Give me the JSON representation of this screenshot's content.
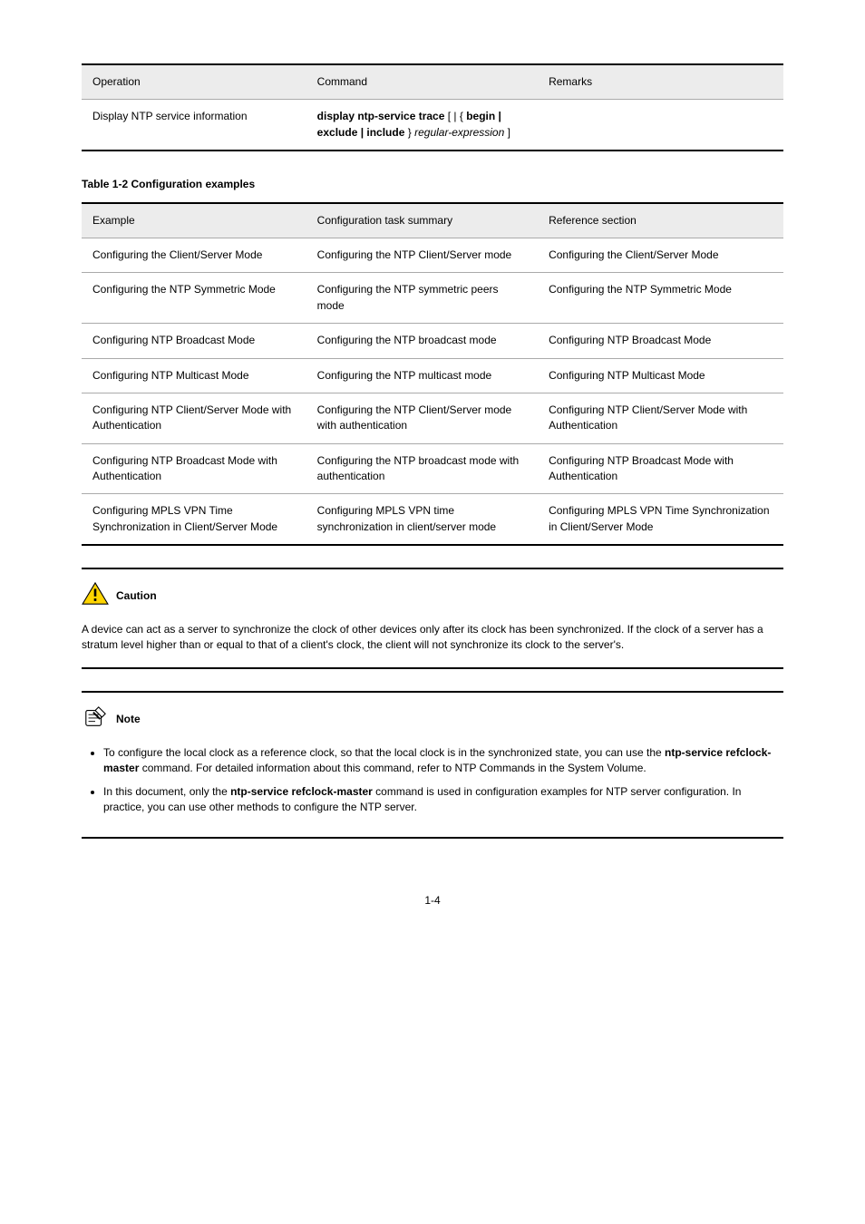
{
  "table1": {
    "headers": [
      "Operation",
      "Command",
      "Remarks"
    ],
    "rows": [
      {
        "op": "Display NTP service information",
        "cmd_prefix": "display ntp-service trace",
        "cmd_slot": " [ | { ",
        "cmd_opts": "begin | exclude | include",
        "cmd_suffix_a": " } ",
        "cmd_suffix_b": "regular-expression",
        "cmd_suffix_c": " ]",
        "remarks": ""
      }
    ]
  },
  "table2_caption": "Table 1-2 Configuration examples",
  "table2": {
    "headers": [
      "Example",
      "Configuration task summary",
      "Reference section"
    ],
    "rows": [
      {
        "example": "Configuring the Client/Server Mode",
        "task": "Configuring the NTP Client/Server mode",
        "ref": "Configuring the Client/Server Mode"
      },
      {
        "example": "Configuring the NTP Symmetric Mode",
        "task": "Configuring the NTP symmetric peers mode",
        "ref": "Configuring the NTP Symmetric Mode"
      },
      {
        "example": "Configuring NTP Broadcast Mode",
        "task": "Configuring the NTP broadcast mode",
        "ref": "Configuring NTP Broadcast Mode"
      },
      {
        "example": "Configuring NTP Multicast Mode",
        "task": "Configuring the NTP multicast mode",
        "ref": "Configuring NTP Multicast Mode"
      },
      {
        "example": "Configuring NTP Client/Server Mode with Authentication",
        "task": "Configuring the NTP Client/Server mode with authentication",
        "ref": "Configuring NTP Client/Server Mode with Authentication"
      },
      {
        "example": "Configuring NTP Broadcast Mode with Authentication",
        "task": "Configuring the NTP broadcast mode with authentication",
        "ref": "Configuring NTP Broadcast Mode with Authentication"
      },
      {
        "example": "Configuring MPLS VPN Time Synchronization in Client/Server Mode",
        "task": "Configuring MPLS VPN time synchronization in client/server mode",
        "ref": "Configuring MPLS VPN Time Synchronization in Client/Server Mode"
      }
    ]
  },
  "caution": {
    "label": "Caution",
    "text": "A device can act as a server to synchronize the clock of other devices only after its clock has been synchronized. If the clock of a server has a stratum level higher than or equal to that of a client's clock, the client will not synchronize its clock to the server's."
  },
  "note": {
    "label": "Note",
    "bullets": [
      {
        "prefix": "To configure the local clock as a reference clock, so that the local clock is in the synchronized state, you can use the ",
        "bold": "ntp-service refclock-master",
        "suffix": " command. For detailed information about this command, refer to NTP Commands in the System Volume."
      },
      {
        "prefix": "In this document, only the ",
        "bold": "ntp-service refclock-master",
        "suffix": " command is used in configuration examples for NTP server configuration. In practice, you can use other methods to configure the NTP server."
      }
    ]
  },
  "page_number": "1-4"
}
